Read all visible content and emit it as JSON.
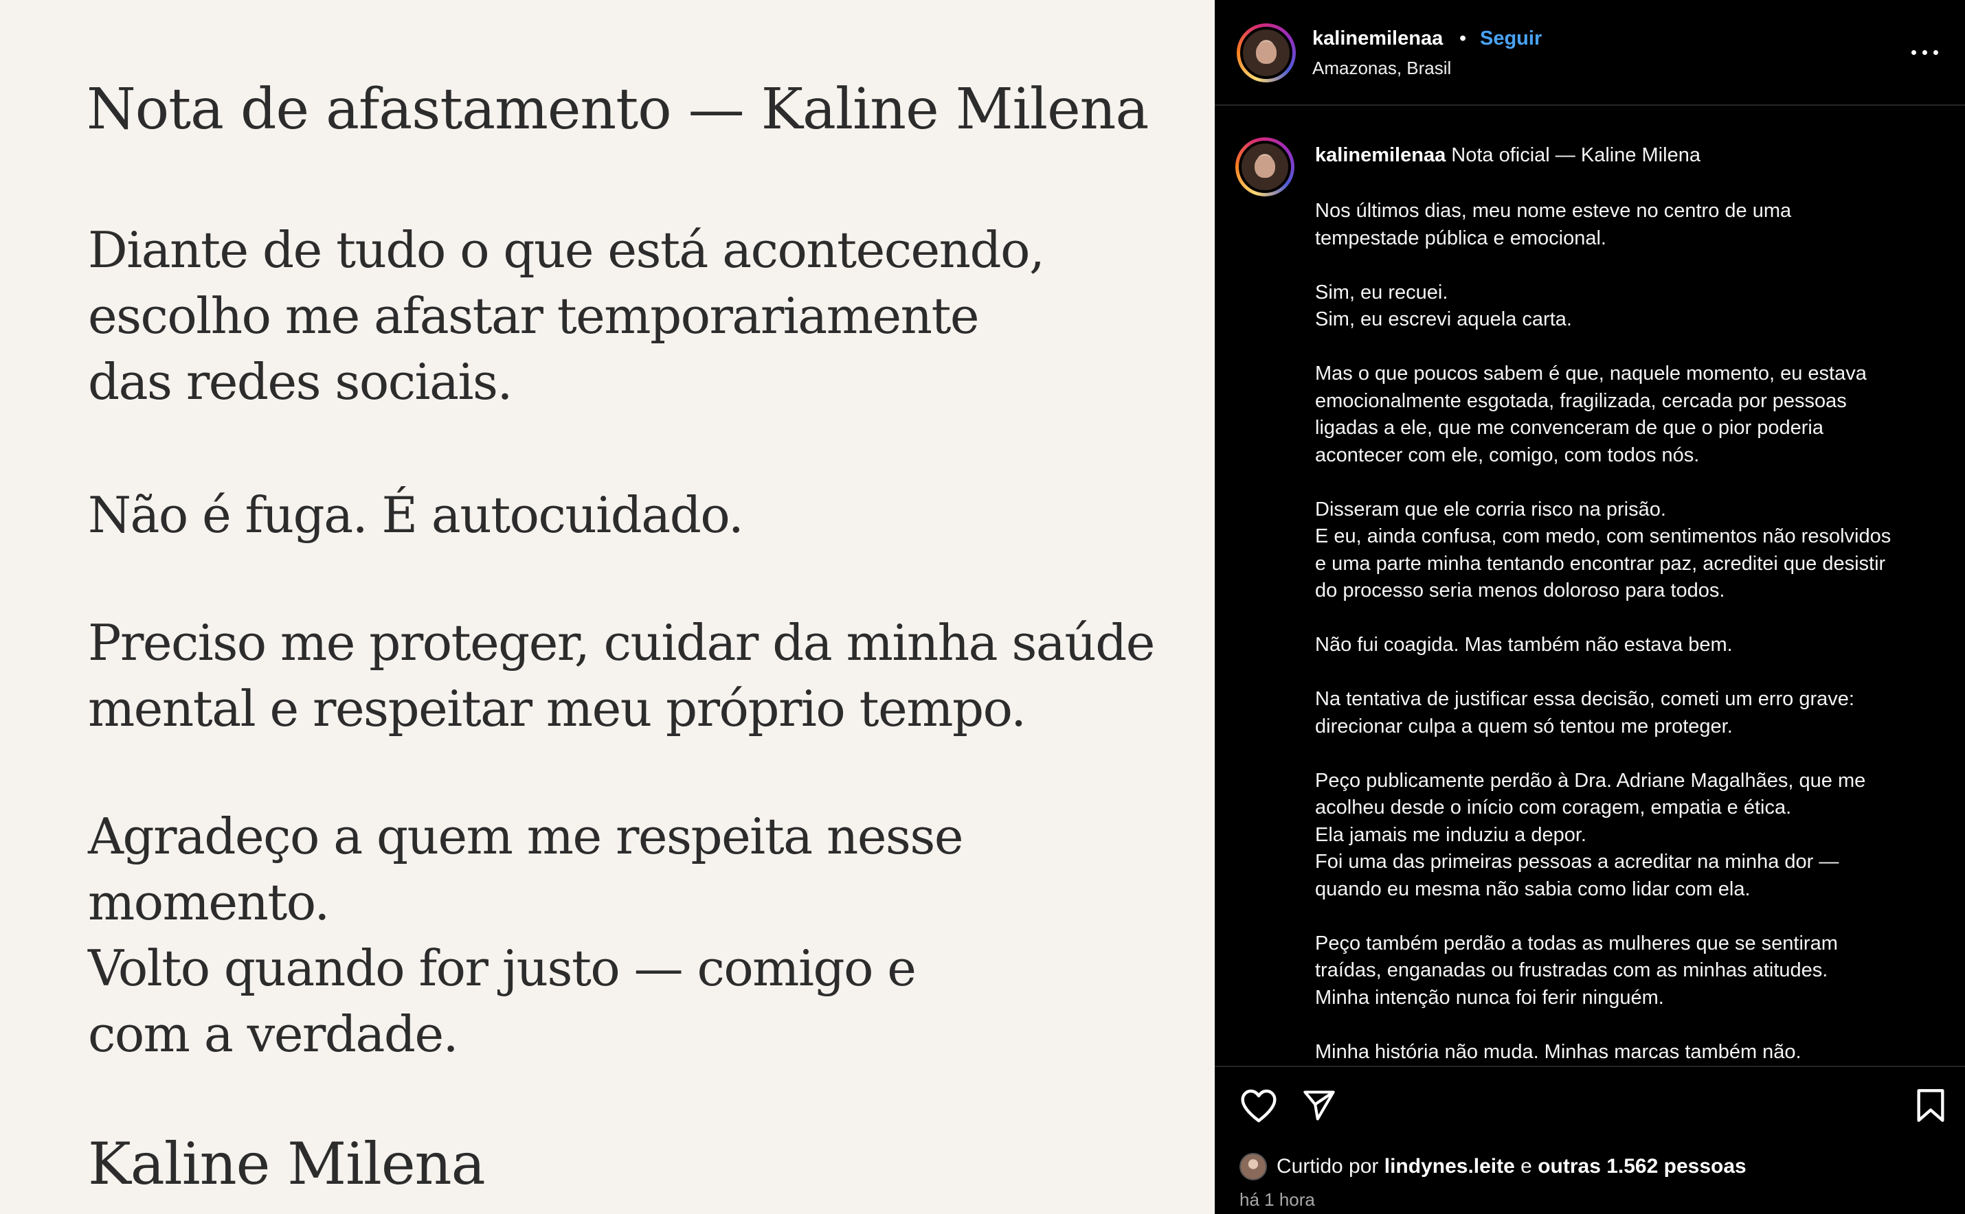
{
  "post": {
    "title": "Nota de afastamento — Kaline Milena",
    "paragraphs": [
      "Diante de tudo o que está acontecendo,\nescolho me afastar temporariamente\ndas redes sociais.",
      "Não é fuga. É autocuidado.",
      "Preciso me proteger, cuidar da minha saúde\nmental e respeitar meu próprio tempo.",
      "Agradeço a quem me respeita nesse momento.\nVolto quando for justo — comigo e\ncom a verdade."
    ],
    "signature": "Kaline Milena"
  },
  "header": {
    "username": "kalinemilenaa",
    "separator": "•",
    "follow_label": "Seguir",
    "location": "Amazonas, Brasil"
  },
  "caption": {
    "username": "kalinemilenaa",
    "title": "Nota oficial — Kaline Milena",
    "body": "Nos últimos dias, meu nome esteve no centro de uma\ntempestade pública e emocional.\n\nSim, eu recuei.\nSim, eu escrevi aquela carta.\n\nMas o que poucos sabem é que, naquele momento, eu estava\nemocionalmente esgotada, fragilizada, cercada por pessoas\nligadas a ele, que me convenceram de que o pior poderia\nacontecer com ele, comigo, com todos nós.\n\nDisseram que ele corria risco na prisão.\nE eu, ainda confusa, com medo, com sentimentos não resolvidos\ne uma parte minha tentando encontrar paz, acreditei que desistir\ndo processo seria menos doloroso para todos.\n\nNão fui coagida. Mas também não estava bem.\n\nNa tentativa de justificar essa decisão, cometi um erro grave:\ndirecionar culpa a quem só tentou me proteger.\n\nPeço publicamente perdão à Dra. Adriane Magalhães, que me\nacolheu desde o início com coragem, empatia e ética.\nEla jamais me induziu a depor.\nFoi uma das primeiras pessoas a acreditar na minha dor —\nquando eu mesma não sabia como lidar com ela.\n\nPeço também perdão a todas as mulheres que se sentiram\ntraídas, enganadas ou frustradas com as minhas atitudes.\nMinha intenção nunca foi ferir ninguém.\n\nMinha história não muda. Minhas marcas também não."
  },
  "likes": {
    "prefix": "Curtido por",
    "liker": "lindynes.leite",
    "connector": "e",
    "others": "outras 1.562 pessoas"
  },
  "timestamp": "há 1 hora",
  "icons": {
    "like": "heart-icon",
    "share": "paper-plane-icon",
    "save": "bookmark-icon",
    "more": "more-horizontal-icon"
  },
  "colors": {
    "panel_bg": "#000000",
    "image_bg": "#f6f3ee",
    "follow": "#4aa3f5"
  }
}
